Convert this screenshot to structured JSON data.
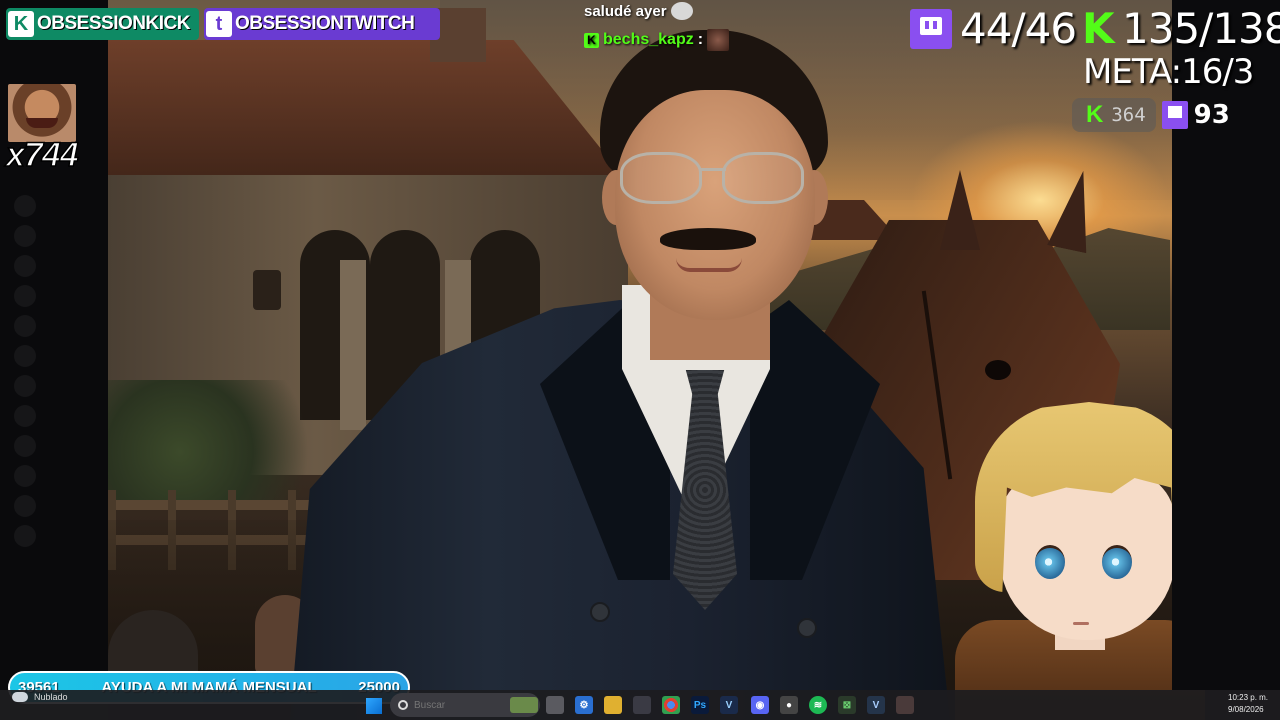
{
  "badges": {
    "kick_label": "OBSESSIONKICK",
    "twitch_label": "OBSESSIONTWITCH"
  },
  "emote_counter": "x744",
  "chat": {
    "line1_text": "saludé ayer",
    "line2_user": "bechs_kapz",
    "line2_colon": ":"
  },
  "stats": {
    "twitch_subs": "44/46",
    "kick_subs": "135/138",
    "meta": "META:16/3",
    "kick_viewers": "364",
    "twitch_viewers": "93"
  },
  "goal": {
    "current": "39561",
    "title": "AYUDA A MI MAMÁ MENSUAL",
    "target": "25000"
  },
  "taskbar": {
    "weather": "Nublado",
    "search_placeholder": "Buscar",
    "time": "10:23 p. m.",
    "date": "9/08/2026"
  },
  "colors": {
    "kick_green": "#53fc18",
    "twitch_purple": "#8a4ff0",
    "goal_blue": "#1cc6e6"
  }
}
